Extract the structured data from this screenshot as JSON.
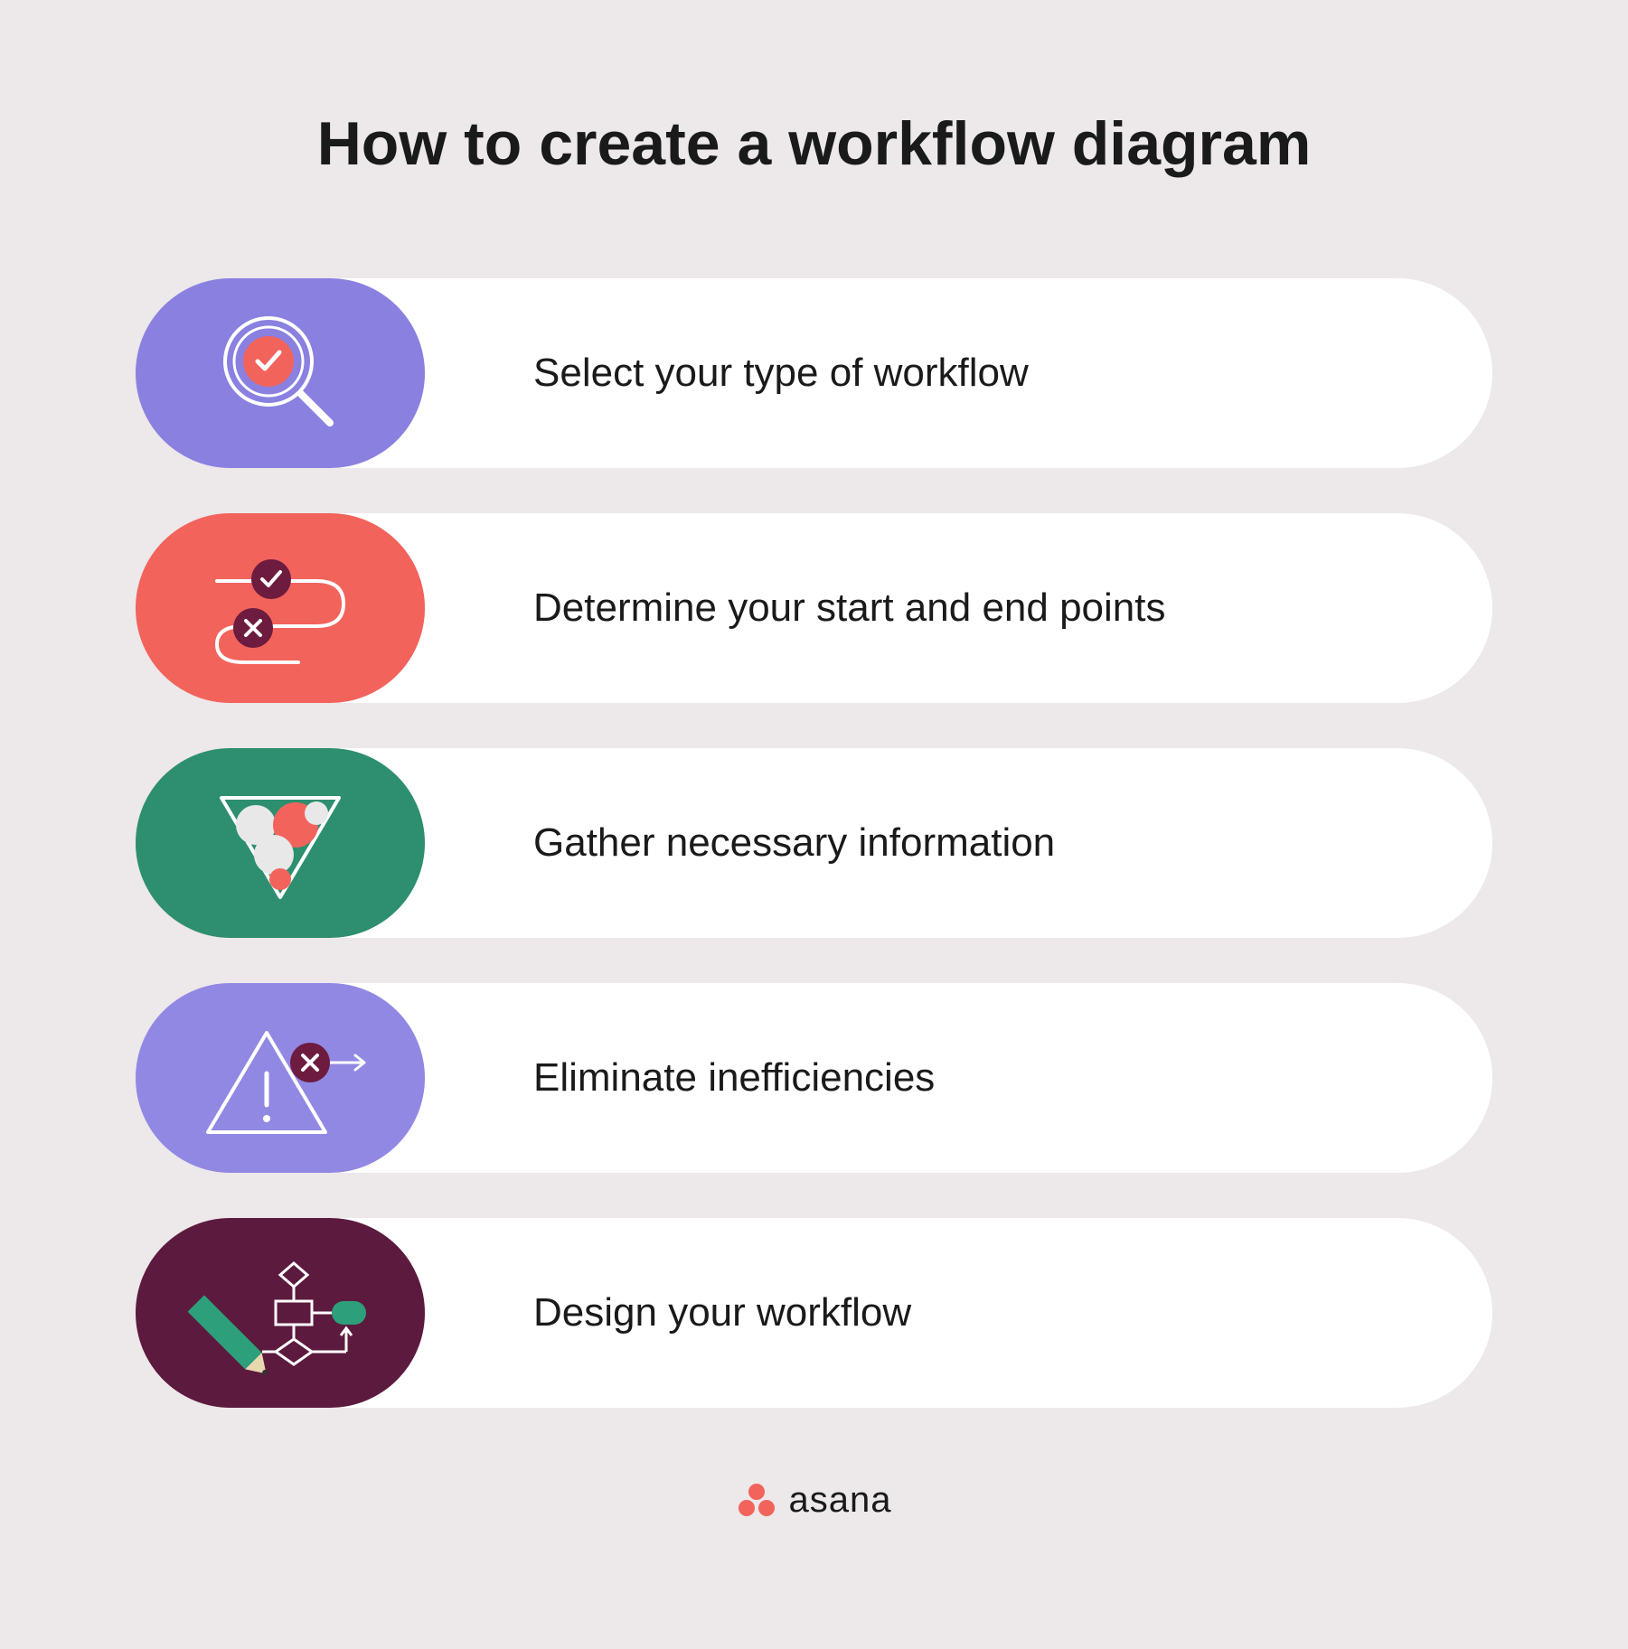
{
  "title": "How to create a workflow diagram",
  "steps": [
    {
      "label": "Select your type of workflow",
      "color": "purple",
      "icon": "magnify-check-icon"
    },
    {
      "label": "Determine your start and end points",
      "color": "coral",
      "icon": "path-check-x-icon"
    },
    {
      "label": "Gather necessary information",
      "color": "green",
      "icon": "funnel-circles-icon"
    },
    {
      "label": "Eliminate inefficiencies",
      "color": "purple2",
      "icon": "warning-arrow-icon"
    },
    {
      "label": "Design your workflow",
      "color": "maroon",
      "icon": "flowchart-pencil-icon"
    }
  ],
  "footer": {
    "brand": "asana"
  },
  "colors": {
    "purple": "#8a80e0",
    "coral": "#f2635c",
    "green": "#2d8f6f",
    "purple2": "#9188e4",
    "maroon": "#5c1a3e",
    "accent_coral": "#f2635c",
    "accent_maroon": "#6d1b3e"
  }
}
